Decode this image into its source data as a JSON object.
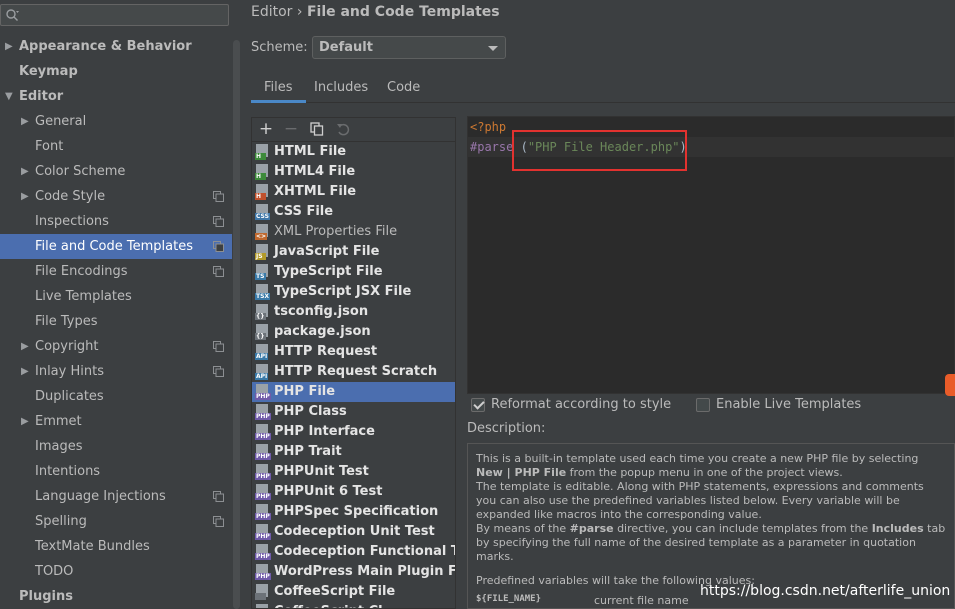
{
  "search": {
    "value": "",
    "icon": "search-icon"
  },
  "tree": [
    {
      "label": "Appearance & Behavior",
      "level": 0,
      "bold": true,
      "arrow": "right"
    },
    {
      "label": "Keymap",
      "level": 0,
      "bold": true,
      "arrow": ""
    },
    {
      "label": "Editor",
      "level": 0,
      "bold": true,
      "arrow": "down"
    },
    {
      "label": "General",
      "level": 1,
      "arrow": "right"
    },
    {
      "label": "Font",
      "level": 1,
      "arrow": ""
    },
    {
      "label": "Color Scheme",
      "level": 1,
      "arrow": "right"
    },
    {
      "label": "Code Style",
      "level": 1,
      "arrow": "right",
      "project": true
    },
    {
      "label": "Inspections",
      "level": 1,
      "arrow": "",
      "project": true
    },
    {
      "label": "File and Code Templates",
      "level": 1,
      "arrow": "",
      "project": true,
      "selected": true
    },
    {
      "label": "File Encodings",
      "level": 1,
      "arrow": "",
      "project": true
    },
    {
      "label": "Live Templates",
      "level": 1,
      "arrow": ""
    },
    {
      "label": "File Types",
      "level": 1,
      "arrow": ""
    },
    {
      "label": "Copyright",
      "level": 1,
      "arrow": "right",
      "project": true
    },
    {
      "label": "Inlay Hints",
      "level": 1,
      "arrow": "right",
      "project": true
    },
    {
      "label": "Duplicates",
      "level": 1,
      "arrow": ""
    },
    {
      "label": "Emmet",
      "level": 1,
      "arrow": "right"
    },
    {
      "label": "Images",
      "level": 1,
      "arrow": ""
    },
    {
      "label": "Intentions",
      "level": 1,
      "arrow": ""
    },
    {
      "label": "Language Injections",
      "level": 1,
      "arrow": "",
      "project": true
    },
    {
      "label": "Spelling",
      "level": 1,
      "arrow": "",
      "project": true
    },
    {
      "label": "TextMate Bundles",
      "level": 1,
      "arrow": ""
    },
    {
      "label": "TODO",
      "level": 1,
      "arrow": ""
    },
    {
      "label": "Plugins",
      "level": 0,
      "bold": true,
      "arrow": ""
    }
  ],
  "breadcrumb": {
    "parent": "Editor",
    "separator": "›",
    "current": "File and Code Templates"
  },
  "scheme": {
    "label": "Scheme:",
    "value": "Default"
  },
  "tabs": [
    {
      "label": "Files",
      "active": true
    },
    {
      "label": "Includes",
      "active": false
    },
    {
      "label": "Code",
      "active": false
    }
  ],
  "toolbar": {
    "add": "+",
    "remove": "−",
    "copy": "copy",
    "reset": "reset"
  },
  "templates": [
    {
      "name": "HTML File",
      "tag": "H",
      "tagColor": "#3d8a3a",
      "bold": true
    },
    {
      "name": "HTML4 File",
      "tag": "H",
      "tagColor": "#3d8a3a",
      "bold": true
    },
    {
      "name": "XHTML File",
      "tag": "H",
      "tagColor": "#c0512d",
      "bold": true
    },
    {
      "name": "CSS File",
      "tag": "CSS",
      "tagColor": "#3f77a8",
      "bold": true
    },
    {
      "name": "XML Properties File",
      "tag": "<>",
      "tagColor": "#c0682d",
      "bold": false
    },
    {
      "name": "JavaScript File",
      "tag": "JS",
      "tagColor": "#b29a2a",
      "bold": true
    },
    {
      "name": "TypeScript File",
      "tag": "TS",
      "tagColor": "#3a7aa8",
      "bold": true
    },
    {
      "name": "TypeScript JSX File",
      "tag": "TSX",
      "tagColor": "#3a7aa8",
      "bold": true
    },
    {
      "name": "tsconfig.json",
      "tag": "{}",
      "tagColor": "#6c7278",
      "bold": true
    },
    {
      "name": "package.json",
      "tag": "{}",
      "tagColor": "#6c7278",
      "bold": true
    },
    {
      "name": "HTTP Request",
      "tag": "API",
      "tagColor": "#3a7aa8",
      "bold": true
    },
    {
      "name": "HTTP Request Scratch",
      "tag": "API",
      "tagColor": "#3a7aa8",
      "bold": true
    },
    {
      "name": "PHP File",
      "tag": "PHP",
      "tagColor": "#6f5aa8",
      "bold": true,
      "selected": true
    },
    {
      "name": "PHP Class",
      "tag": "PHP",
      "tagColor": "#6f5aa8",
      "bold": true
    },
    {
      "name": "PHP Interface",
      "tag": "PHP",
      "tagColor": "#6f5aa8",
      "bold": true
    },
    {
      "name": "PHP Trait",
      "tag": "PHP",
      "tagColor": "#6f5aa8",
      "bold": true
    },
    {
      "name": "PHPUnit Test",
      "tag": "PHP",
      "tagColor": "#6f5aa8",
      "bold": true
    },
    {
      "name": "PHPUnit 6 Test",
      "tag": "PHP",
      "tagColor": "#6f5aa8",
      "bold": true
    },
    {
      "name": "PHPSpec Specification",
      "tag": "PHP",
      "tagColor": "#6f5aa8",
      "bold": true
    },
    {
      "name": "Codeception Unit Test",
      "tag": "PHP",
      "tagColor": "#6f5aa8",
      "bold": true
    },
    {
      "name": "Codeception Functional Test",
      "tag": "PHP",
      "tagColor": "#6f5aa8",
      "bold": true
    },
    {
      "name": "WordPress Main Plugin File",
      "tag": "PHP",
      "tagColor": "#6f5aa8",
      "bold": true
    },
    {
      "name": "CoffeeScript File",
      "tag": "",
      "tagColor": "#6c7278",
      "bold": true
    },
    {
      "name": "CoffeeScript Cl",
      "tag": "",
      "tagColor": "#6c7278",
      "bold": true
    }
  ],
  "editor": {
    "line1": "<?php",
    "line2_kw": "#parse",
    "line2_open": " (",
    "line2_str": "\"PHP File Header.php\"",
    "line2_close": ")"
  },
  "options": {
    "reformat": {
      "label": "Reformat according to style",
      "checked": true
    },
    "live": {
      "label": "Enable Live Templates",
      "checked": false
    }
  },
  "description": {
    "label": "Description:",
    "p1a": "This is a built-in template used each time you create a new PHP file by selecting ",
    "p1b": "New | PHP File",
    "p1c": " from the popup menu in one of the project views.",
    "p2": "The template is editable. Along with PHP statements, expressions and comments you can also use the predefined variables listed below. Every variable will be expanded like macros into the corresponding value.",
    "p3a": "By means of the ",
    "p3b": "#parse",
    "p3c": " directive, you can include templates from the ",
    "p3d": "Includes",
    "p3e": " tab by specifying the full name of the desired template as a parameter in quotation marks.",
    "p4": "Predefined variables will take the following values:",
    "var_key": "${FILE_NAME}",
    "var_val": "current file name"
  },
  "watermark": "https://blog.csdn.net/afterlife_union",
  "colors": {
    "selection": "#4b6eaf",
    "accent": "#4a88c7",
    "highlight_box": "#e2322f"
  }
}
